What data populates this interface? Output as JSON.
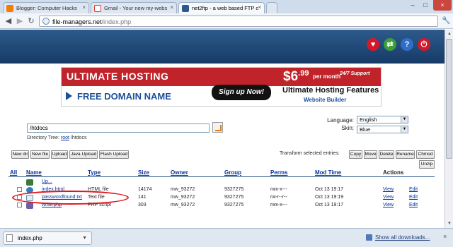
{
  "browser": {
    "tabs": [
      {
        "title": "Blogger: Computer Hacks",
        "favicon_color": "#f57d00"
      },
      {
        "title": "Gmail - Your new my-webs",
        "favicon_color": "#d33b2c"
      },
      {
        "title": "net2ftp - a web based FTP c",
        "favicon_color": "#2d5a8c"
      }
    ],
    "url_host": "file-managers.net",
    "url_path": "/index.php"
  },
  "banner": {
    "ultimate_hosting": "ULTIMATE HOSTING",
    "free_domain": "FREE DOMAIN NAME",
    "price_dollars": "$6",
    "price_cents": ".99",
    "per_month": "per month",
    "support": "24/7 Support",
    "signup": "Sign up Now!",
    "features": "Ultimate Hosting Features",
    "builder": "Website Builder"
  },
  "ftp": {
    "directory": "/htdocs",
    "tree_label": "Directory Tree:",
    "tree_root": "root",
    "tree_path": "/htdocs",
    "language_label": "Language:",
    "language_value": "English",
    "skin_label": "Skin:",
    "skin_value": "Blue",
    "buttons": [
      "New dir",
      "New file",
      "Upload",
      "Java Upload",
      "Flash Upload"
    ],
    "transform_label": "Transform selected entries:",
    "transform_buttons": [
      "Copy",
      "Move",
      "Delete",
      "Rename",
      "Chmod"
    ],
    "unzip": "Unzip",
    "columns": [
      "All",
      "Name",
      "Type",
      "Size",
      "Owner",
      "Group",
      "Perms",
      "Mod Time",
      "Actions"
    ],
    "rows": [
      {
        "name": "Up...",
        "type": "",
        "size": "",
        "owner": "",
        "group": "",
        "perms": "",
        "mtime": "",
        "view": "",
        "edit": ""
      },
      {
        "name": "index.html",
        "type": "HTML file",
        "size": "14174",
        "owner": "mw_93272",
        "group": "9327275",
        "perms": "rwx-x---",
        "mtime": "Oct 13 19:17",
        "view": "View",
        "edit": "Edit"
      },
      {
        "name": "passwordfound.txt",
        "type": "Text file",
        "size": "141",
        "owner": "mw_93272",
        "group": "9327275",
        "perms": "rw-r--r--",
        "mtime": "Oct 13 19:19",
        "view": "View",
        "edit": "Edit"
      },
      {
        "name": "write.php",
        "type": "PHP script",
        "size": "303",
        "owner": "mw_93272",
        "group": "9327275",
        "perms": "rwx-x---",
        "mtime": "Oct 13 19:17",
        "view": "View",
        "edit": "Edit"
      }
    ]
  },
  "downloads": {
    "file": "index.php",
    "show_all": "Show all downloads..."
  },
  "colors": {
    "header": "#1f4777",
    "highlight": "#e0141b",
    "banner_red": "#c0242a"
  }
}
